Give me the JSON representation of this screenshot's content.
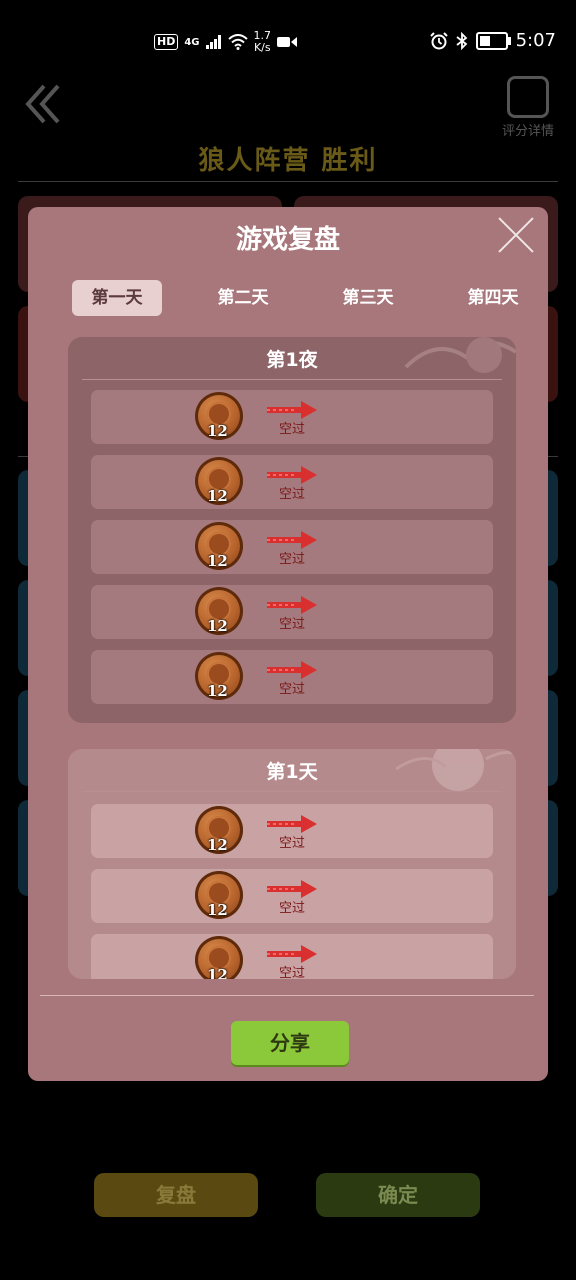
{
  "status_bar": {
    "network": "HD",
    "signal": "4G",
    "speed_value": "1.7",
    "speed_unit": "K/s",
    "time": "5:07"
  },
  "background": {
    "title": "狼人阵营  胜利",
    "detail_label": "评分详情",
    "review_button": "复盘",
    "confirm_button": "确定"
  },
  "modal": {
    "title": "游戏复盘",
    "tabs": [
      {
        "label": "第一天",
        "active": true
      },
      {
        "label": "第二天",
        "active": false
      },
      {
        "label": "第三天",
        "active": false
      },
      {
        "label": "第四天",
        "active": false
      }
    ],
    "night": {
      "title": "第1夜",
      "rows": [
        {
          "seat": "12",
          "action": "空过"
        },
        {
          "seat": "12",
          "action": "空过"
        },
        {
          "seat": "12",
          "action": "空过"
        },
        {
          "seat": "12",
          "action": "空过"
        },
        {
          "seat": "12",
          "action": "空过"
        }
      ]
    },
    "day": {
      "title": "第1天",
      "rows": [
        {
          "seat": "12",
          "action": "空过"
        },
        {
          "seat": "12",
          "action": "空过"
        },
        {
          "seat": "12",
          "action": "空过"
        }
      ]
    },
    "share_button": "分享"
  },
  "colors": {
    "modal_bg": "#a8777b",
    "share_green": "#8bc83a",
    "arrow_red": "#d9302f"
  }
}
